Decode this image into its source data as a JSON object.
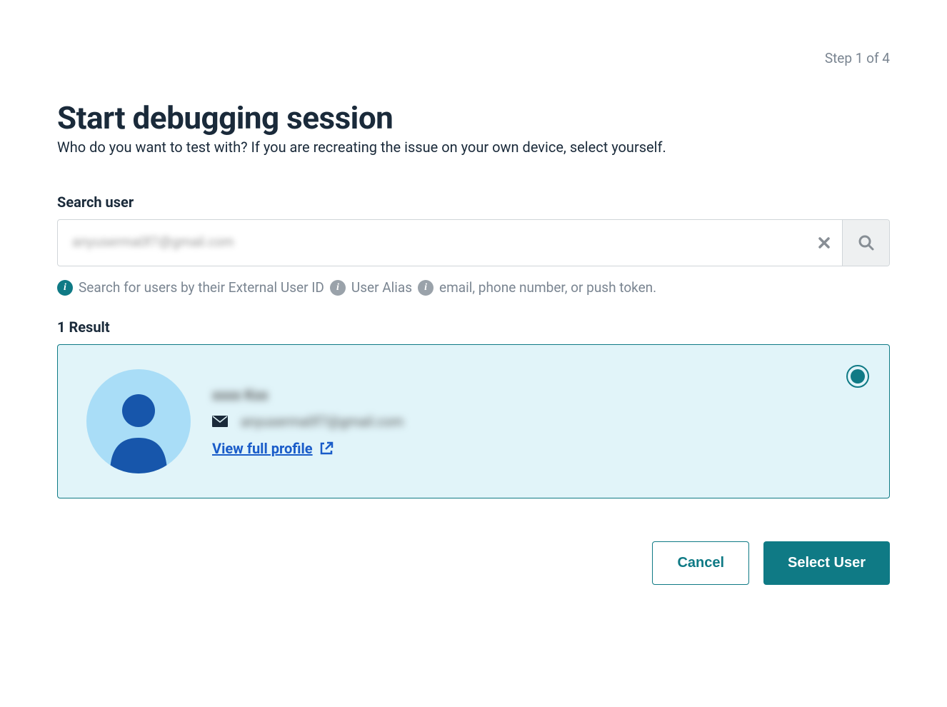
{
  "header": {
    "step_text": "Step 1 of 4",
    "title": "Start debugging session"
  },
  "description": "Who do you want to test with? If you are recreating the issue on your own device, select yourself.",
  "search": {
    "label": "Search user",
    "value": "anyuserma0f7@gmail.com",
    "hint_prefix": "Search for users by their External User ID",
    "hint_alias": "User Alias",
    "hint_suffix": "email, phone number, or push token."
  },
  "results": {
    "label": "1 Result",
    "user": {
      "name": "xxxx Kxx",
      "email": "anyuserma0f7@gmail.com",
      "profile_link": "View full profile"
    }
  },
  "actions": {
    "cancel": "Cancel",
    "select": "Select User"
  }
}
